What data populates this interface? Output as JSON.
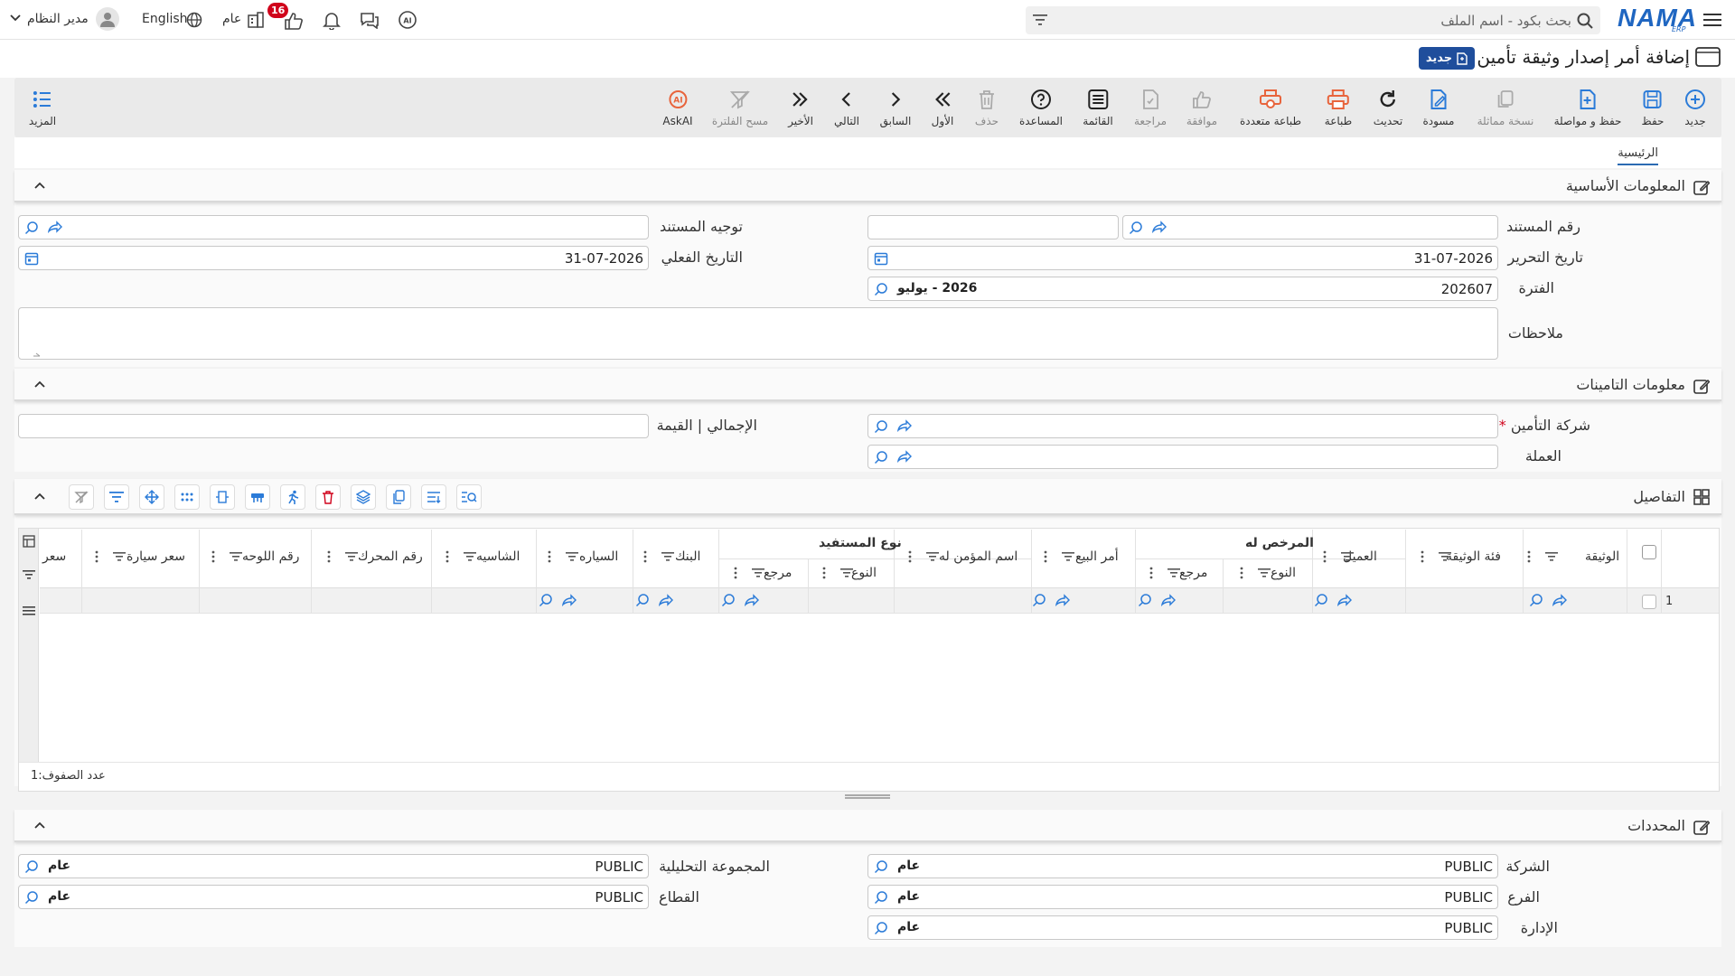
{
  "topbar": {
    "search_placeholder": "بحث بكود - اسم الملف",
    "brand": "NAMA",
    "brand_sub": "ERP",
    "language": "English",
    "scope": "عام",
    "notifications_count": "16",
    "user": "مدير النظام"
  },
  "page": {
    "title": "إضافة أمر إصدار وثيقة تأمين",
    "new_badge": "جديد"
  },
  "toolbar": {
    "items": [
      {
        "label": "جديد",
        "icon": "plus-circle-icon"
      },
      {
        "label": "حفظ",
        "icon": "save-icon"
      },
      {
        "label": "حفظ و مواصلة",
        "icon": "save-continue-icon"
      },
      {
        "label": "نسخة مماثلة",
        "icon": "duplicate-icon"
      },
      {
        "label": "مسودة",
        "icon": "draft-icon"
      },
      {
        "label": "تحديث",
        "icon": "refresh-icon"
      },
      {
        "label": "طباعة",
        "icon": "print-icon"
      },
      {
        "label": "طباعة متعددة",
        "icon": "multi-print-icon"
      },
      {
        "label": "موافقة",
        "icon": "approve-icon"
      },
      {
        "label": "مراجعة",
        "icon": "review-icon"
      },
      {
        "label": "القائمة",
        "icon": "list-icon"
      },
      {
        "label": "المساعدة",
        "icon": "help-icon"
      },
      {
        "label": "حذف",
        "icon": "trash-icon"
      },
      {
        "label": "الأول",
        "icon": "first-icon"
      },
      {
        "label": "السابق",
        "icon": "previous-icon"
      },
      {
        "label": "التالي",
        "icon": "next-icon"
      },
      {
        "label": "الأخير",
        "icon": "last-icon"
      },
      {
        "label": "مسح الفلترة",
        "icon": "clear-filter-icon"
      },
      {
        "label": "AskAI",
        "icon": "ai-icon"
      }
    ],
    "more_label": "المزيد"
  },
  "breadcrumb": "الرئيسية",
  "sections": {
    "basic": "المعلومات الأساسية",
    "insurance": "معلومات التامينات",
    "details": "التفاصيل",
    "dimensions": "المحددات"
  },
  "basic": {
    "doc_number_label": "رقم المستند",
    "doc_number_value": "",
    "issue_date_label": "تاريخ التحرير",
    "issue_date_value": "31-07-2026",
    "period_label": "الفترة",
    "period_value": "202607",
    "period_name": "2026 - يوليو",
    "direction_label": "توجيه المستند",
    "actual_date_label": "التاريخ الفعلي",
    "actual_date_value": "31-07-2026",
    "notes_label": "ملاحظات"
  },
  "insurance": {
    "company_label": "شركة التأمين",
    "required_mark": "*",
    "currency_label": "العملة",
    "total_label": "الإجمالي | القيمة"
  },
  "details_grid": {
    "group_headers": [
      "المرخص له",
      "نوع المستفيد"
    ],
    "columns": [
      "الوثيقة",
      "فئة الوثيقة",
      "العميل",
      "النوع",
      "مرجع",
      "أمر البيع",
      "اسم المؤمن له",
      "النوع",
      "مرجع",
      "البنك",
      "السياره",
      "الشاسيه",
      "رقم المحرك",
      "رقم اللوحه",
      "سعر سيارة",
      "سعر"
    ],
    "row_number": "1",
    "row_count_label": "عدد الصفوف:",
    "row_count": "1"
  },
  "dimensions": {
    "company_label": "الشركة",
    "company_value": "PUBLIC",
    "company_name": "عام",
    "branch_label": "الفرع",
    "branch_value": "PUBLIC",
    "branch_name": "عام",
    "department_label": "الإدارة",
    "department_value": "PUBLIC",
    "department_name": "عام",
    "analytic_label": "المجموعة التحليلية",
    "analytic_value": "PUBLIC",
    "analytic_name": "عام",
    "sector_label": "القطاع",
    "sector_value": "PUBLIC",
    "sector_name": "عام"
  },
  "colors": {
    "brand": "#1f66c1",
    "accent_orange": "#e8643c",
    "required": "#d0021b"
  }
}
